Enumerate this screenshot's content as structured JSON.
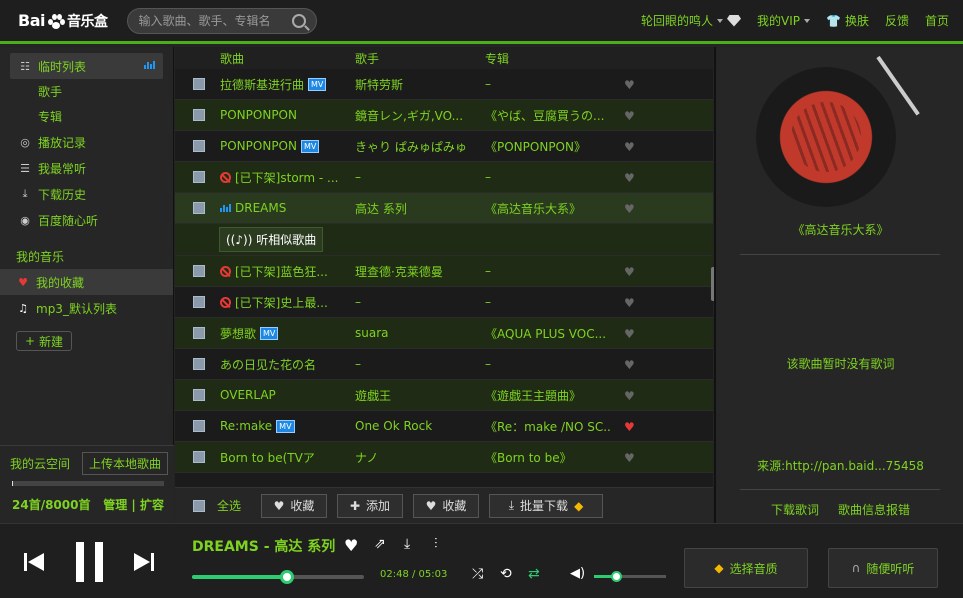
{
  "header": {
    "logo_text": "Bai",
    "logo_text2": "音乐盒",
    "search_placeholder": "输入歌曲、歌手、专辑名",
    "user": "轮回眼的鸣人",
    "vip": "我的VIP",
    "skin": "换肤",
    "feedback": "反馈",
    "home": "首页"
  },
  "sidebar": {
    "temp_list": "临时列表",
    "singer": "歌手",
    "album": "专辑",
    "history": "播放记录",
    "most_played": "我最常听",
    "downloads": "下载历史",
    "random": "百度随心听",
    "my_music": "我的音乐",
    "favorites": "我的收藏",
    "default_list": "mp3_默认列表",
    "new_label": "新建",
    "cloud": "我的云空间",
    "upload": "上传本地歌曲",
    "cloud_count": "24首/8000首",
    "cloud_progress": 0.003,
    "manage": "管理",
    "expand": "扩容"
  },
  "list": {
    "col_song": "歌曲",
    "col_artist": "歌手",
    "col_album": "专辑",
    "rows": [
      {
        "title": "拉德斯基进行曲",
        "artist": "斯特劳斯",
        "album": "–",
        "mv": true,
        "ban": false,
        "bars": false,
        "fav": false,
        "alt": false
      },
      {
        "title": "PONPONPON",
        "artist": "鏡音レン,ギガ,VO...",
        "album": "《やば、豆腐買うの...",
        "mv": false,
        "ban": false,
        "bars": false,
        "fav": false,
        "alt": true
      },
      {
        "title": "PONPONPON",
        "artist": "きゃり ぱみゅぱみゅ",
        "album": "《PONPONPON》",
        "mv": true,
        "ban": false,
        "bars": false,
        "fav": false,
        "alt": false
      },
      {
        "title": "[已下架]storm - ...",
        "artist": "–",
        "album": "–",
        "mv": false,
        "ban": true,
        "bars": false,
        "fav": false,
        "alt": true
      },
      {
        "title": "DREAMS",
        "artist": "高达 系列",
        "album": "《高达音乐大系》",
        "mv": false,
        "ban": false,
        "bars": true,
        "fav": false,
        "alt": false,
        "sel": true
      }
    ],
    "similar": "听相似歌曲",
    "rows2": [
      {
        "title": "[已下架]蓝色狂...",
        "artist": "理查德·克莱德曼",
        "album": "–",
        "mv": false,
        "ban": true,
        "fav": false,
        "alt": true
      },
      {
        "title": "[已下架]史上最...",
        "artist": "–",
        "album": "–",
        "mv": false,
        "ban": true,
        "fav": false,
        "alt": false
      },
      {
        "title": "夢想歌",
        "artist": "suara",
        "album": "《AQUA PLUS VOC...",
        "mv": true,
        "ban": false,
        "fav": false,
        "alt": true
      },
      {
        "title": "あの日见た花の名",
        "artist": "–",
        "album": "–",
        "mv": false,
        "ban": false,
        "fav": false,
        "alt": false
      },
      {
        "title": "OVERLAP",
        "artist": "遊戯王",
        "album": "《遊戯王主題曲》",
        "mv": false,
        "ban": false,
        "fav": false,
        "alt": true
      },
      {
        "title": "Re:make",
        "artist": "One Ok Rock",
        "album": "《Re：make /NO SC...",
        "mv": true,
        "ban": false,
        "fav": true,
        "alt": false
      },
      {
        "title": "Born to be(TVア",
        "artist": "ナノ",
        "album": "《Born to be》",
        "mv": false,
        "ban": false,
        "fav": false,
        "alt": true
      }
    ],
    "select_all": "全选",
    "btn_collect": "收藏",
    "btn_add": "添加",
    "btn_collect2": "收藏",
    "btn_download": "批量下载"
  },
  "right": {
    "album_name": "《高达音乐大系》",
    "no_lyrics": "该歌曲暂时没有歌词",
    "source": "来源:http://pan.baid...75458",
    "download_lyrics": "下载歌词",
    "report": "歌曲信息报错"
  },
  "player": {
    "now_playing": "DREAMS  -  高达 系列",
    "time": "02:48 / 05:03",
    "progress": 0.55,
    "volume": 0.3,
    "quality": "选择音质",
    "random_listen": "随便听听"
  },
  "colors": {
    "accent": "#7ed321",
    "bg": "#242424",
    "progress": "#2ecc71",
    "mv": "#1e88e5",
    "ban": "#e53935"
  }
}
